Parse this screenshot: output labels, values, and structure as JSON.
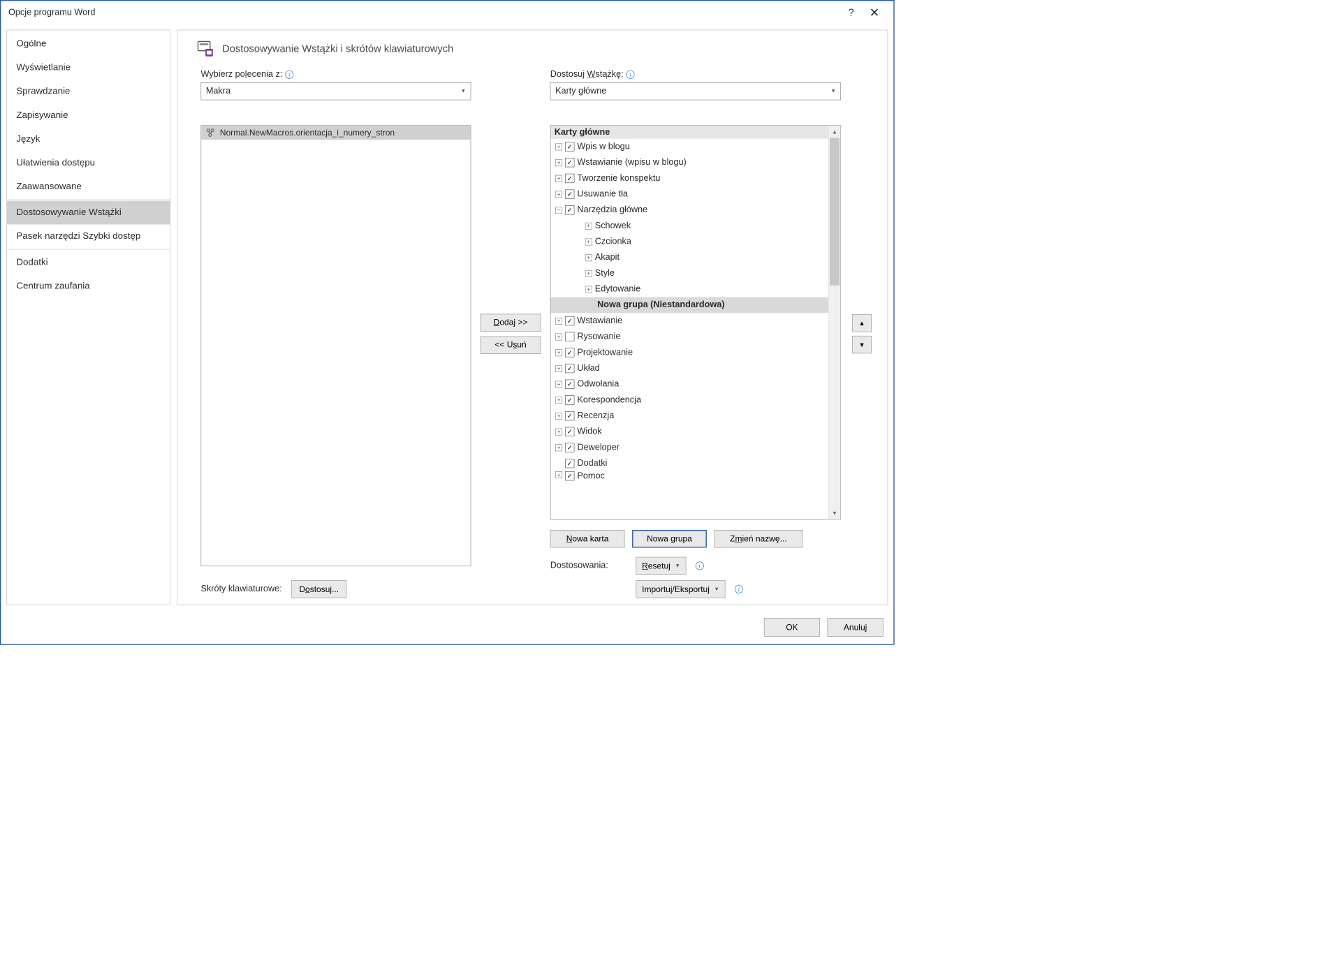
{
  "titlebar": {
    "title": "Opcje programu Word"
  },
  "sidebar": {
    "items": [
      "Ogólne",
      "Wyświetlanie",
      "Sprawdzanie",
      "Zapisywanie",
      "Język",
      "Ułatwienia dostępu",
      "Zaawansowane",
      "Dostosowywanie Wstążki",
      "Pasek narzędzi Szybki dostęp",
      "Dodatki",
      "Centrum zaufania"
    ],
    "selected_index": 7
  },
  "main": {
    "heading": "Dostosowywanie Wstążki i skrótów klawiaturowych",
    "left": {
      "label_pre": "Wybierz po",
      "label_u": "l",
      "label_post": "ecenia z:",
      "dropdown_value": "Makra",
      "items": [
        "Normal.NewMacros.orientacja_i_numery_stron"
      ]
    },
    "center": {
      "add_pre": "",
      "add_u": "D",
      "add_post": "odaj >>",
      "remove_pre": "<< U",
      "remove_u": "s",
      "remove_post": "uń"
    },
    "right": {
      "label_pre": "Dostosuj ",
      "label_u": "W",
      "label_post": "stążkę:",
      "dropdown_value": "Karty główne",
      "tree_header": "Karty główne",
      "tree": [
        {
          "expander": "+",
          "checked": true,
          "label": "Wpis w blogu",
          "indent": 0
        },
        {
          "expander": "+",
          "checked": true,
          "label": "Wstawianie (wpisu w blogu)",
          "indent": 0
        },
        {
          "expander": "+",
          "checked": true,
          "label": "Tworzenie konspektu",
          "indent": 0
        },
        {
          "expander": "+",
          "checked": true,
          "label": "Usuwanie tła",
          "indent": 0
        },
        {
          "expander": "-",
          "checked": true,
          "label": "Narzędzia główne",
          "indent": 0
        },
        {
          "expander": "+",
          "checked": null,
          "label": "Schowek",
          "indent": 2
        },
        {
          "expander": "+",
          "checked": null,
          "label": "Czcionka",
          "indent": 2
        },
        {
          "expander": "+",
          "checked": null,
          "label": "Akapit",
          "indent": 2
        },
        {
          "expander": "+",
          "checked": null,
          "label": "Style",
          "indent": 2
        },
        {
          "expander": "+",
          "checked": null,
          "label": "Edytowanie",
          "indent": 2
        },
        {
          "expander": "",
          "checked": null,
          "label": "Nowa grupa (Niestandardowa)",
          "indent": 3,
          "selected": true
        },
        {
          "expander": "+",
          "checked": true,
          "label": "Wstawianie",
          "indent": 0
        },
        {
          "expander": "+",
          "checked": false,
          "label": "Rysowanie",
          "indent": 0
        },
        {
          "expander": "+",
          "checked": true,
          "label": "Projektowanie",
          "indent": 0
        },
        {
          "expander": "+",
          "checked": true,
          "label": "Układ",
          "indent": 0
        },
        {
          "expander": "+",
          "checked": true,
          "label": "Odwołania",
          "indent": 0
        },
        {
          "expander": "+",
          "checked": true,
          "label": "Korespondencja",
          "indent": 0
        },
        {
          "expander": "+",
          "checked": true,
          "label": "Recenzja",
          "indent": 0
        },
        {
          "expander": "+",
          "checked": true,
          "label": "Widok",
          "indent": 0
        },
        {
          "expander": "+",
          "checked": true,
          "label": "Deweloper",
          "indent": 0
        },
        {
          "expander": "",
          "checked": true,
          "label": "Dodatki",
          "indent": 0,
          "no_expander": true
        },
        {
          "expander": "+",
          "checked": true,
          "label": "Pomoc",
          "indent": 0,
          "cut": true
        }
      ],
      "new_tab_pre": "",
      "new_tab_u": "N",
      "new_tab_post": "owa karta",
      "new_group": "Nowa grupa",
      "rename_pre": "Z",
      "rename_u": "m",
      "rename_post": "ień nazwę...",
      "custom_label": "Dostosowania:",
      "reset_pre": "",
      "reset_u": "R",
      "reset_post": "esetuj",
      "import_export": "Importuj/Eksportuj"
    },
    "kb": {
      "label": "Skróty klawiaturowe:",
      "btn_pre": "D",
      "btn_u": "o",
      "btn_post": "stosuj..."
    }
  },
  "footer": {
    "ok": "OK",
    "cancel": "Anuluj"
  }
}
